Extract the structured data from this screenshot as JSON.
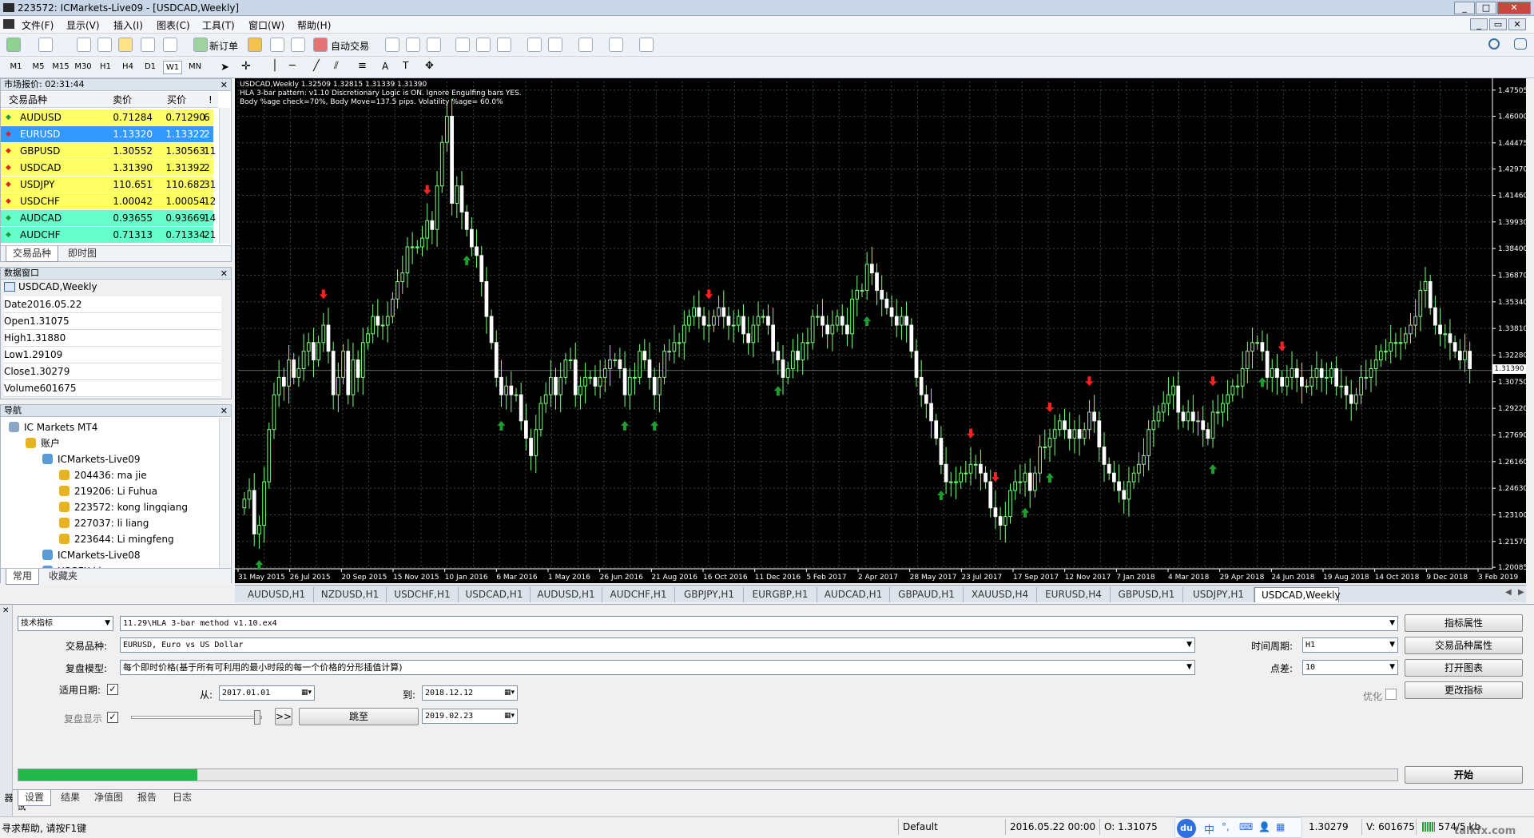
{
  "window": {
    "title": "223572: ICMarkets-Live09 - [USDCAD,Weekly]",
    "buttons": [
      "_",
      "□",
      "✕"
    ],
    "child_buttons": [
      "_",
      "▭",
      "✕"
    ]
  },
  "menu": [
    "文件(F)",
    "显示(V)",
    "插入(I)",
    "图表(C)",
    "工具(T)",
    "窗口(W)",
    "帮助(H)"
  ],
  "toolbar": {
    "new_order": "新订单",
    "auto_trade": "自动交易"
  },
  "timeframes": [
    "M1",
    "M5",
    "M15",
    "M30",
    "H1",
    "H4",
    "D1",
    "W1",
    "MN"
  ],
  "active_timeframe": "W1",
  "market_watch": {
    "title": "市场报价: 02:31:44",
    "headers": [
      "交易品种",
      "卖价",
      "买价",
      "!"
    ],
    "rows": [
      {
        "symbol": "AUDUSD",
        "bid": "0.71284",
        "ask": "0.71290",
        "spread": "6",
        "bg": "#ffff66",
        "dir": "up"
      },
      {
        "symbol": "EURUSD",
        "bid": "1.13320",
        "ask": "1.13322",
        "spread": "2",
        "bg": "#3399ff",
        "dir": "down"
      },
      {
        "symbol": "GBPUSD",
        "bid": "1.30552",
        "ask": "1.30563",
        "spread": "11",
        "bg": "#ffff66",
        "dir": "down"
      },
      {
        "symbol": "USDCAD",
        "bid": "1.31390",
        "ask": "1.31392",
        "spread": "2",
        "bg": "#ffff66",
        "dir": "down"
      },
      {
        "symbol": "USDJPY",
        "bid": "110.651",
        "ask": "110.682",
        "spread": "31",
        "bg": "#ffff66",
        "dir": "down"
      },
      {
        "symbol": "USDCHF",
        "bid": "1.00042",
        "ask": "1.00054",
        "spread": "12",
        "bg": "#ffff66",
        "dir": "down"
      },
      {
        "symbol": "AUDCAD",
        "bid": "0.93655",
        "ask": "0.93669",
        "spread": "14",
        "bg": "#66ffcc",
        "dir": "up"
      },
      {
        "symbol": "AUDCHF",
        "bid": "0.71313",
        "ask": "0.71334",
        "spread": "21",
        "bg": "#66ffcc",
        "dir": "up"
      }
    ],
    "tabs": [
      "交易品种",
      "即时图"
    ]
  },
  "data_window": {
    "title": "数据窗口",
    "symbol": "USDCAD,Weekly",
    "rows": [
      [
        "Date",
        "2016.05.22"
      ],
      [
        "Open",
        "1.31075"
      ],
      [
        "High",
        "1.31880"
      ],
      [
        "Low",
        "1.29109"
      ],
      [
        "Close",
        "1.30279"
      ],
      [
        "Volume",
        "601675"
      ]
    ]
  },
  "navigator": {
    "title": "导航",
    "items": [
      {
        "label": "IC Markets MT4",
        "level": 0,
        "icon": "terminal"
      },
      {
        "label": "账户",
        "level": 1,
        "icon": "accounts"
      },
      {
        "label": "ICMarkets-Live09",
        "level": 2,
        "icon": "server"
      },
      {
        "label": "204436: ma jie",
        "level": 3,
        "icon": "user"
      },
      {
        "label": "219206: Li Fuhua",
        "level": 3,
        "icon": "user"
      },
      {
        "label": "223572: kong lingqiang",
        "level": 3,
        "icon": "user"
      },
      {
        "label": "227037: li liang",
        "level": 3,
        "icon": "user"
      },
      {
        "label": "223644: Li mingfeng",
        "level": 3,
        "icon": "user"
      },
      {
        "label": "ICMarkets-Live08",
        "level": 2,
        "icon": "server"
      },
      {
        "label": "USGFX-Live",
        "level": 2,
        "icon": "server"
      }
    ],
    "tabs": [
      "常用",
      "收藏夹"
    ]
  },
  "chart": {
    "info_lines": [
      "USDCAD,Weekly  1.32509 1.32815 1.31339 1.31390",
      "HLA 3-bar pattern: v1.10 Discretionary Logic is ON. Ignore Engulfing bars YES.",
      "Body %age check=70%, Body Move=137.5 pips. Volatility %age= 60.0%"
    ],
    "current_price": "1.31390"
  },
  "chart_data": {
    "type": "candlestick",
    "y_ticks": [
      "1.47505",
      "1.46000",
      "1.44475",
      "1.42970",
      "1.41460",
      "1.39930",
      "1.38400",
      "1.36870",
      "1.35340",
      "1.33810",
      "1.32280",
      "1.30750",
      "1.29220",
      "1.27690",
      "1.26160",
      "1.24630",
      "1.23100",
      "1.21570",
      "1.20085"
    ],
    "ylim": [
      1.2,
      1.48
    ],
    "x_ticks": [
      "31 May 2015",
      "26 Jul 2015",
      "20 Sep 2015",
      "15 Nov 2015",
      "10 Jan 2016",
      "6 Mar 2016",
      "1 May 2016",
      "26 Jun 2016",
      "21 Aug 2016",
      "16 Oct 2016",
      "11 Dec 2016",
      "5 Feb 2017",
      "2 Apr 2017",
      "28 May 2017",
      "23 Jul 2017",
      "17 Sep 2017",
      "12 Nov 2017",
      "7 Jan 2018",
      "4 Mar 2018",
      "29 Apr 2018",
      "24 Jun 2018",
      "19 Aug 2018",
      "14 Oct 2018",
      "9 Dec 2018",
      "3 Feb 2019"
    ],
    "closes": [
      1.24,
      1.245,
      1.22,
      1.225,
      1.25,
      1.28,
      1.3,
      1.31,
      1.305,
      1.32,
      1.31,
      1.315,
      1.325,
      1.33,
      1.32,
      1.33,
      1.34,
      1.325,
      1.3,
      1.31,
      1.325,
      1.3,
      1.32,
      1.31,
      1.33,
      1.335,
      1.345,
      1.34,
      1.34,
      1.345,
      1.355,
      1.365,
      1.37,
      1.385,
      1.385,
      1.385,
      1.39,
      1.4,
      1.395,
      1.42,
      1.445,
      1.46,
      1.41,
      1.42,
      1.405,
      1.395,
      1.385,
      1.38,
      1.365,
      1.345,
      1.33,
      1.31,
      1.3,
      1.305,
      1.3,
      1.3,
      1.285,
      1.275,
      1.265,
      1.28,
      1.295,
      1.3,
      1.31,
      1.3,
      1.31,
      1.32,
      1.32,
      1.3,
      1.305,
      1.31,
      1.31,
      1.305,
      1.31,
      1.315,
      1.32,
      1.32,
      1.315,
      1.3,
      1.31,
      1.31,
      1.325,
      1.32,
      1.31,
      1.3,
      1.31,
      1.325,
      1.325,
      1.33,
      1.33,
      1.34,
      1.345,
      1.35,
      1.345,
      1.34,
      1.34,
      1.345,
      1.35,
      1.345,
      1.34,
      1.34,
      1.345,
      1.335,
      1.33,
      1.34,
      1.345,
      1.345,
      1.34,
      1.325,
      1.32,
      1.31,
      1.315,
      1.325,
      1.32,
      1.33,
      1.33,
      1.345,
      1.345,
      1.34,
      1.335,
      1.34,
      1.345,
      1.34,
      1.335,
      1.355,
      1.36,
      1.36,
      1.375,
      1.37,
      1.36,
      1.355,
      1.35,
      1.345,
      1.34,
      1.345,
      1.34,
      1.325,
      1.31,
      1.3,
      1.295,
      1.285,
      1.275,
      1.26,
      1.25,
      1.25,
      1.25,
      1.255,
      1.255,
      1.26,
      1.26,
      1.255,
      1.25,
      1.235,
      1.23,
      1.225,
      1.23,
      1.245,
      1.25,
      1.25,
      1.255,
      1.245,
      1.255,
      1.27,
      1.27,
      1.275,
      1.28,
      1.285,
      1.28,
      1.275,
      1.28,
      1.275,
      1.28,
      1.29,
      1.285,
      1.27,
      1.26,
      1.255,
      1.25,
      1.245,
      1.24,
      1.25,
      1.255,
      1.26,
      1.265,
      1.28,
      1.285,
      1.29,
      1.295,
      1.3,
      1.305,
      1.29,
      1.285,
      1.29,
      1.285,
      1.285,
      1.28,
      1.275,
      1.29,
      1.29,
      1.295,
      1.3,
      1.305,
      1.305,
      1.315,
      1.325,
      1.33,
      1.33,
      1.325,
      1.31,
      1.315,
      1.31,
      1.305,
      1.31,
      1.315,
      1.31,
      1.305,
      1.305,
      1.31,
      1.315,
      1.31,
      1.31,
      1.315,
      1.305,
      1.305,
      1.3,
      1.295,
      1.3,
      1.31,
      1.31,
      1.315,
      1.32,
      1.325,
      1.325,
      1.33,
      1.33,
      1.33,
      1.335,
      1.34,
      1.345,
      1.36,
      1.365,
      1.35,
      1.34,
      1.335,
      1.335,
      1.33,
      1.325,
      1.32,
      1.325,
      1.315
    ],
    "up_arrow_at": [
      3,
      45,
      52,
      77,
      83,
      108,
      126,
      141,
      158,
      163,
      196,
      206
    ],
    "down_arrow_at": [
      16,
      37,
      94,
      147,
      152,
      163,
      171,
      196,
      210
    ],
    "current_price": 1.3139
  },
  "chart_tabs": [
    "AUDUSD,H1",
    "NZDUSD,H1",
    "USDCHF,H1",
    "USDCAD,H1",
    "AUDUSD,H1",
    "AUDCHF,H1",
    "GBPJPY,H1",
    "EURGBP,H1",
    "AUDCAD,H1",
    "GBPAUD,H1",
    "XAUUSD,H4",
    "EURUSD,H4",
    "GBPUSD,H1",
    "USDJPY,H1",
    "USDCAD,Weekly"
  ],
  "active_chart_tab": "USDCAD,Weekly",
  "tester": {
    "type_select": "技术指标",
    "indicator_path": "11.29\\HLA 3-bar method v1.10.ex4",
    "symbol_label": "交易品种:",
    "symbol_value": "EURUSD, Euro vs US Dollar",
    "model_label": "复盘模型:",
    "model_value": "每个即时价格(基于所有可利用的最小时段的每一个价格的分形插值计算)",
    "use_date_label": "适用日期:",
    "use_date_checked": "✓",
    "from_label": "从:",
    "from_value": "2017.01.01",
    "to_label": "到:",
    "to_value": "2018.12.12",
    "visual_label": "复盘显示",
    "visual_checked": "✓",
    "ff_label": ">>",
    "skip_label": "跳至",
    "skip_date": "2019.02.23",
    "period_label": "时间周期:",
    "period_value": "H1",
    "spread_label": "点差:",
    "spread_value": "10",
    "optimize_label": "优化",
    "btn_indicator_props": "指标属性",
    "btn_symbol_props": "交易品种属性",
    "btn_open_chart": "打开图表",
    "btn_modify_indicator": "更改指标",
    "btn_start": "开始",
    "progress": 0.13,
    "tabs": [
      "设置",
      "结果",
      "净值图",
      "报告",
      "日志"
    ],
    "side_label": "测试器"
  },
  "status": {
    "help": "寻求帮助, 请按F1键",
    "profile": "Default",
    "datetime": "2016.05.22 00:00",
    "open": "O: 1.31075",
    "close": "1.30279",
    "volume": "V: 601675",
    "traffic": "574/5 kb",
    "ime": [
      "du",
      "中",
      "°,",
      "⌨",
      "👤",
      "▦"
    ],
    "watermark": "talkfx.com"
  }
}
